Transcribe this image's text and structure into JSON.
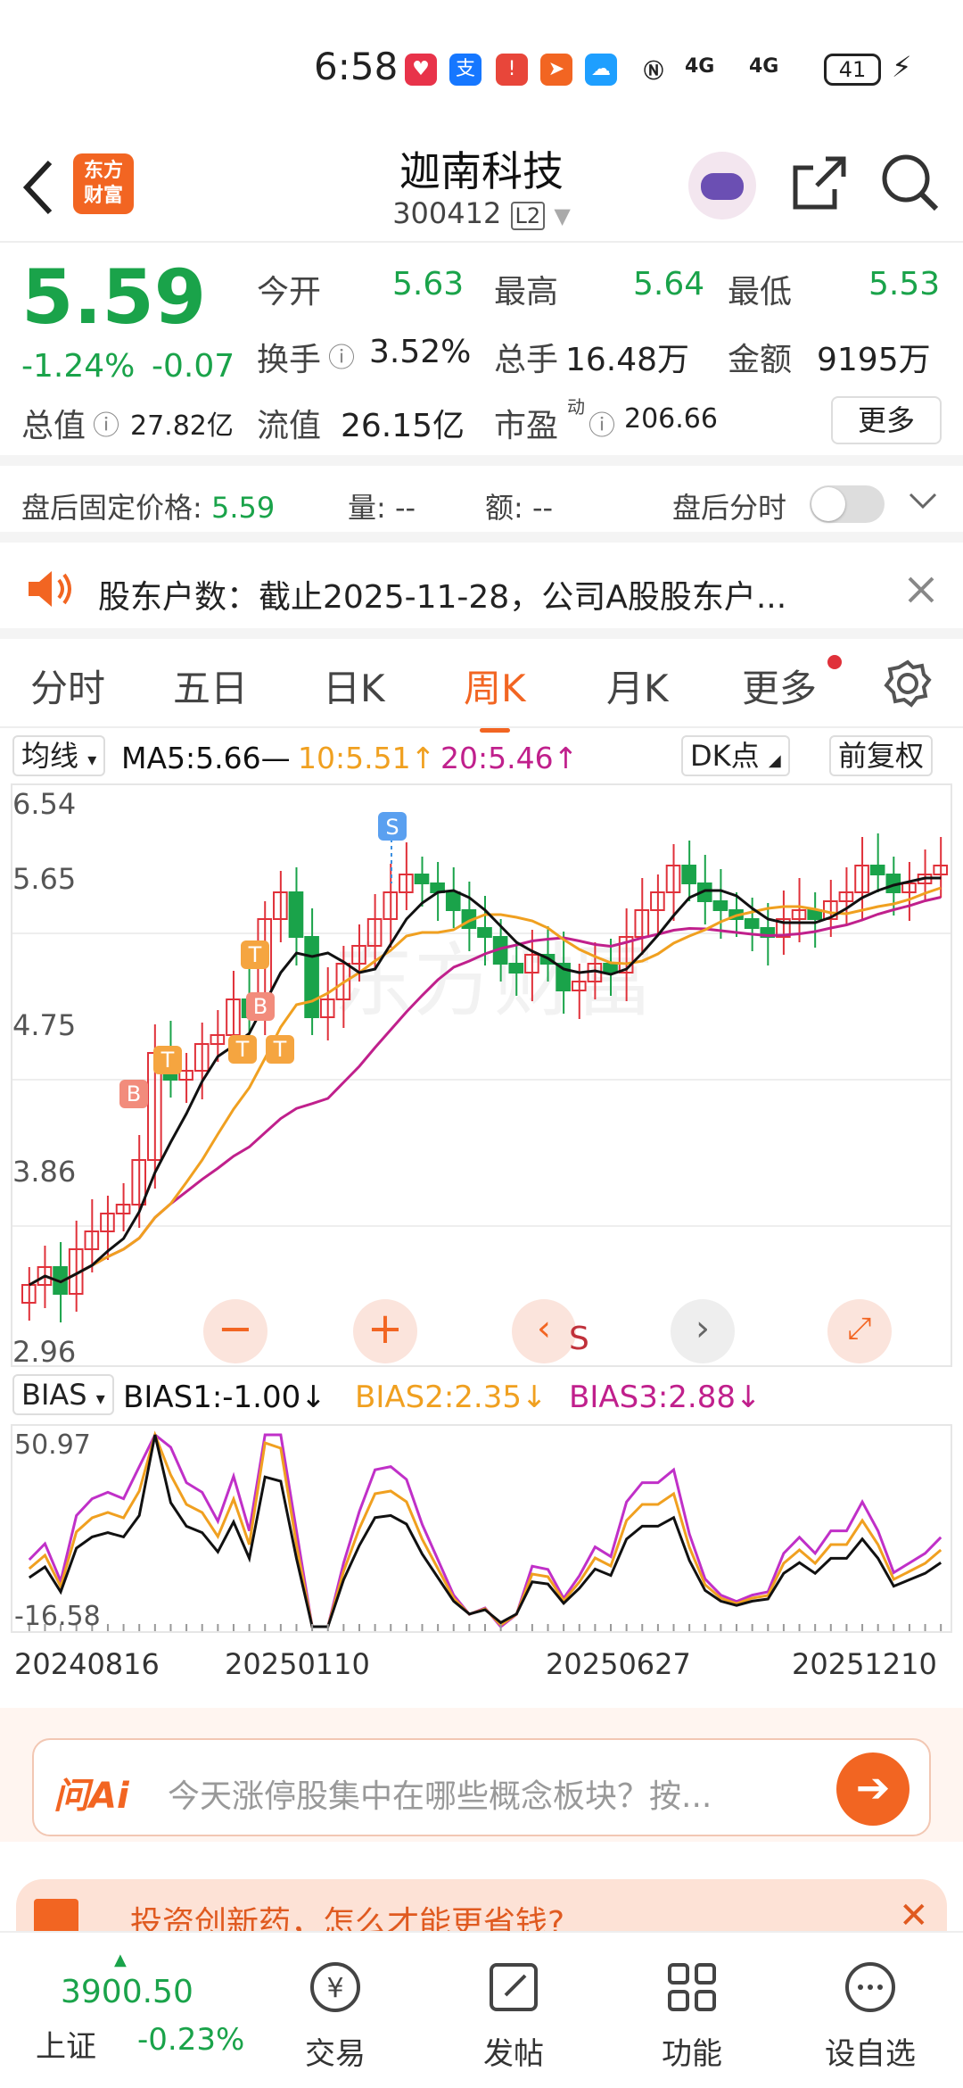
{
  "status": {
    "time": "6:58",
    "signal1": "4G",
    "signal2": "4G",
    "battery": "41"
  },
  "nav": {
    "title": "迦南科技",
    "code": "300412",
    "level": "L2",
    "logo_line1": "东方",
    "logo_line2": "财富"
  },
  "quote": {
    "price": "5.59",
    "pct": "-1.24%",
    "diff": "-0.07",
    "open_label": "今开",
    "open": "5.63",
    "high_label": "最高",
    "high": "5.64",
    "low_label": "最低",
    "low": "5.53",
    "turnover_label": "换手",
    "turnover": "3.52%",
    "volume_label": "总手",
    "volume": "16.48万",
    "amount_label": "金额",
    "amount": "9195万",
    "mktcap_label": "总值",
    "mktcap": "27.82亿",
    "float_label": "流值",
    "float": "26.15亿",
    "pe_label": "市盈",
    "pe_sup": "动",
    "pe": "206.66",
    "more": "更多"
  },
  "after": {
    "label": "盘后固定价格: ",
    "price": "5.59",
    "vol": "量: --",
    "amt": "额: --",
    "toggle_label": "盘后分时"
  },
  "notice": {
    "text": "股东户数：截止2025-11-28，公司A股股东户..."
  },
  "tabs": [
    "分时",
    "五日",
    "日K",
    "周K",
    "月K",
    "更多"
  ],
  "active_tab": "周K",
  "ma": {
    "selector": "均线",
    "ma5": "MA5:5.66—",
    "ma10": "10:5.51↑",
    "ma20": "20:5.46↑",
    "dk": "DK点",
    "fq": "前复权"
  },
  "chart_axis": {
    "y1": "6.54",
    "y2": "5.65",
    "y3": "4.75",
    "y4": "3.86",
    "y5": "2.96"
  },
  "chart_marks": {
    "s_top": "S",
    "s_bottom": "S",
    "b": "B",
    "t": "T"
  },
  "bias": {
    "selector": "BIAS",
    "b1": "BIAS1:-1.00↓",
    "b2": "BIAS2:2.35↓",
    "b3": "BIAS3:2.88↓",
    "ymax": "50.97",
    "ymin": "-16.58"
  },
  "dates": [
    "20240816",
    "20250110",
    "20250627",
    "20251210"
  ],
  "ai": {
    "brand": "问Ai",
    "placeholder": "今天涨停股集中在哪些概念板块？按..."
  },
  "promo": {
    "text": "投资创新药，怎么才能更省钱?"
  },
  "bottom": {
    "index_value": "3900.50",
    "index_name": "上证",
    "index_pct": "-0.23%",
    "items": [
      "交易",
      "发帖",
      "功能",
      "设自选"
    ]
  },
  "colors": {
    "accent": "#f26522",
    "down": "#1aa34a",
    "up": "#e0313a",
    "ma5": "#111111",
    "ma10": "#f0a020",
    "ma20": "#c0208c"
  },
  "chart_data": {
    "type": "candlestick",
    "series": [
      {
        "name": "MA5",
        "last": 5.66
      },
      {
        "name": "10",
        "last": 5.51
      },
      {
        "name": "20",
        "last": 5.46
      }
    ],
    "bias": [
      {
        "name": "BIAS1",
        "last": -1.0
      },
      {
        "name": "BIAS2",
        "last": 2.35
      },
      {
        "name": "BIAS3",
        "last": 2.88
      }
    ]
  }
}
